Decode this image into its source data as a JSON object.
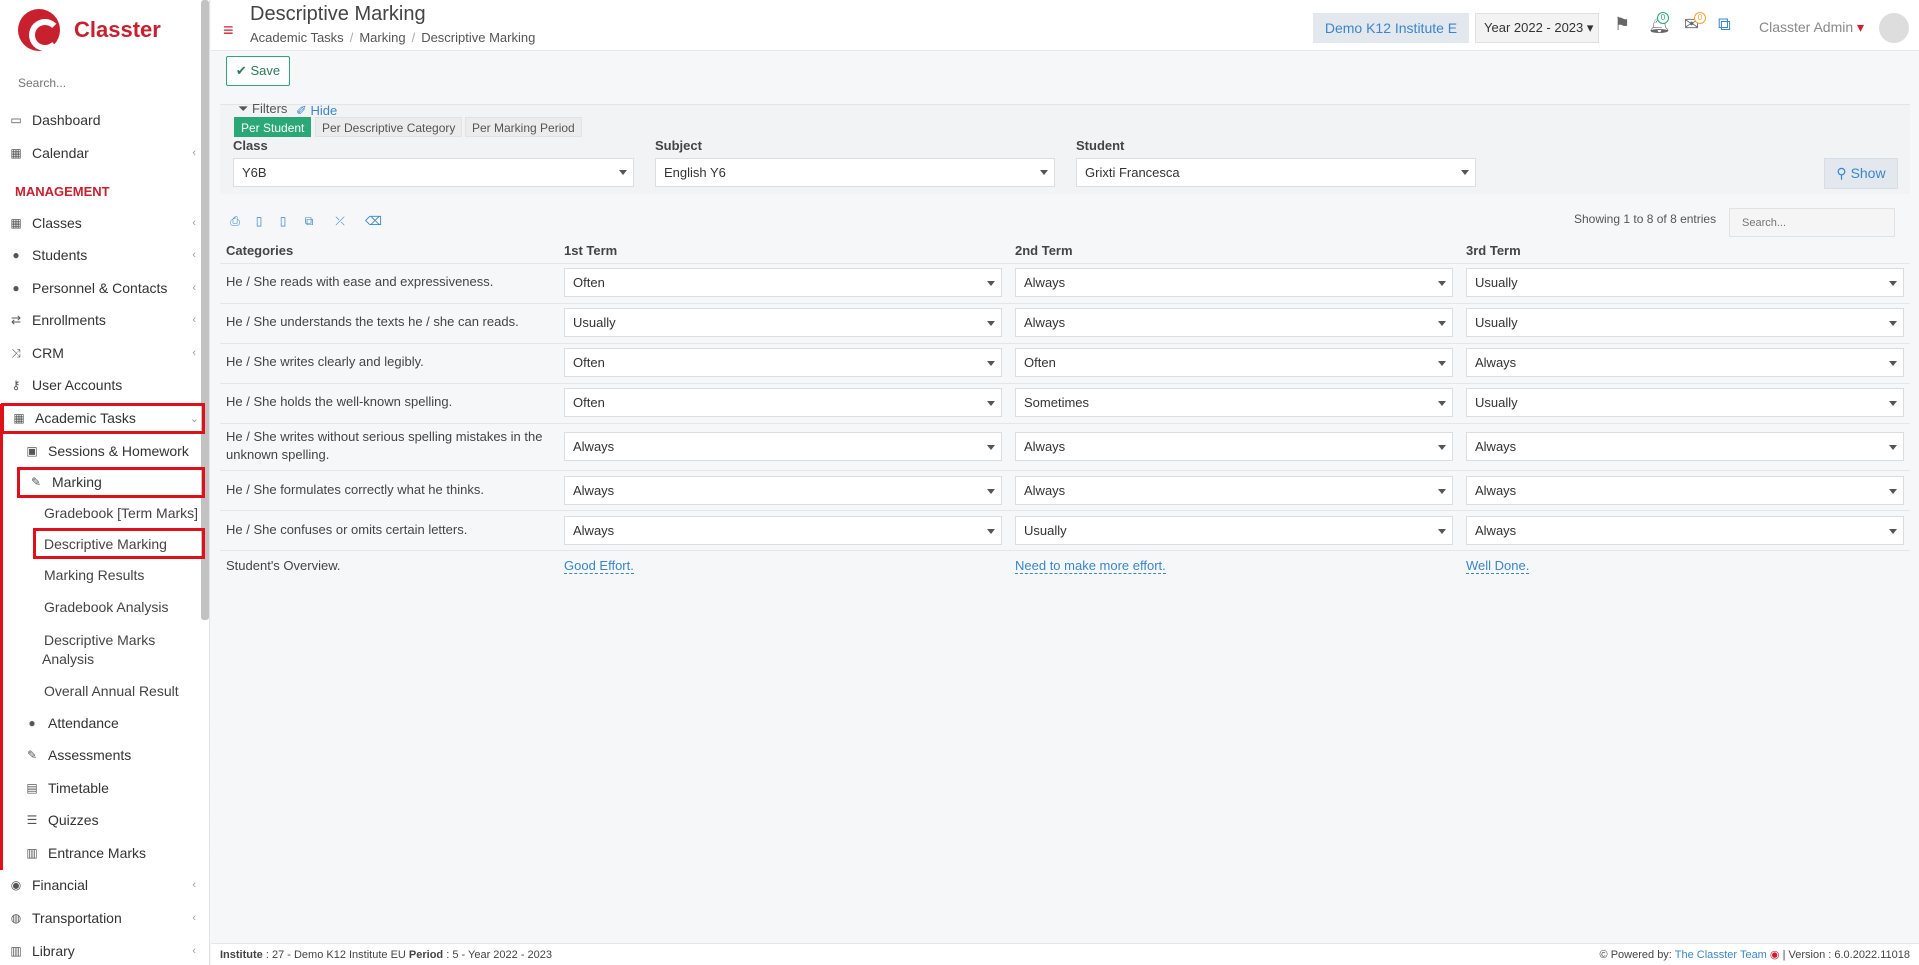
{
  "sidebar": {
    "brand": "Classter",
    "search_placeholder": "Search...",
    "section_management": "MANAGEMENT",
    "items": {
      "dashboard": "Dashboard",
      "calendar": "Calendar",
      "classes": "Classes",
      "students": "Students",
      "personnel": "Personnel & Contacts",
      "enrollments": "Enrollments",
      "crm": "CRM",
      "user_accounts": "User Accounts",
      "academic_tasks": "Academic Tasks",
      "sessions_homework": "Sessions & Homework",
      "marking": "Marking",
      "gradebook_term": "Gradebook [Term Marks]",
      "descriptive_marking": "Descriptive Marking",
      "marking_results": "Marking Results",
      "gradebook_analysis": "Gradebook Analysis",
      "descriptive_marks_analysis_1": "Descriptive Marks",
      "descriptive_marks_analysis_2": "Analysis",
      "overall_annual_result": "Overall Annual Result",
      "attendance": "Attendance",
      "assessments": "Assessments",
      "timetable": "Timetable",
      "quizzes": "Quizzes",
      "entrance_marks": "Entrance Marks",
      "financial": "Financial",
      "transportation": "Transportation",
      "library": "Library"
    }
  },
  "header": {
    "title": "Descriptive Marking",
    "breadcrumb": [
      "Academic Tasks",
      "Marking",
      "Descriptive Marking"
    ],
    "institute": "Demo K12 Institute E",
    "year": "Year 2022 - 2023",
    "notifications_count": "0",
    "messages_count": "0",
    "user": "Classter Admin"
  },
  "toolbar": {
    "save_label": "Save"
  },
  "filters": {
    "label": "Filters",
    "hide_label": "Hide",
    "tabs": [
      "Per Student",
      "Per Descriptive Category",
      "Per Marking Period"
    ],
    "class_label": "Class",
    "class_value": "Y6B",
    "subject_label": "Subject",
    "subject_value": "English Y6",
    "student_label": "Student",
    "student_value": "Grixti Francesca",
    "show_label": "Show"
  },
  "table": {
    "showing": "Showing 1 to 8 of 8 entries",
    "search_placeholder": "Search...",
    "columns": [
      "Categories",
      "1st Term",
      "2nd Term",
      "3rd Term"
    ],
    "rows": [
      {
        "category": "He / She reads with ease and expressiveness.",
        "t1": "Often",
        "t2": "Always",
        "t3": "Usually"
      },
      {
        "category": "He / She understands the texts he / she can reads.",
        "t1": "Usually",
        "t2": "Always",
        "t3": "Usually"
      },
      {
        "category": "He / She writes clearly and legibly.",
        "t1": "Often",
        "t2": "Often",
        "t3": "Always"
      },
      {
        "category": "He / She holds the well-known spelling.",
        "t1": "Often",
        "t2": "Sometimes",
        "t3": "Usually"
      },
      {
        "category": "He / She writes without serious spelling mistakes in the unknown spelling.",
        "t1": "Always",
        "t2": "Always",
        "t3": "Always"
      },
      {
        "category": "He / She formulates correctly what he thinks.",
        "t1": "Always",
        "t2": "Always",
        "t3": "Always"
      },
      {
        "category": "He / She confuses or omits certain letters.",
        "t1": "Always",
        "t2": "Usually",
        "t3": "Always"
      }
    ],
    "overview": {
      "label": "Student's Overview.",
      "t1": "Good Effort.",
      "t2": "Need to make more effort.",
      "t3": "Well Done."
    }
  },
  "footer": {
    "institute_label": "Institute",
    "institute_value": ": 27 - Demo K12 Institute EU",
    "period_label": "Period",
    "period_value": ": 5 - Year 2022 - 2023",
    "powered_by": "Powered by:",
    "team": "The Classter Team",
    "version": "| Version : 6.0.2022.11018"
  },
  "colors": {
    "brand": "#c8202f",
    "accent": "#2aa876",
    "link": "#3b86c8",
    "highlight": "#e0101a"
  }
}
